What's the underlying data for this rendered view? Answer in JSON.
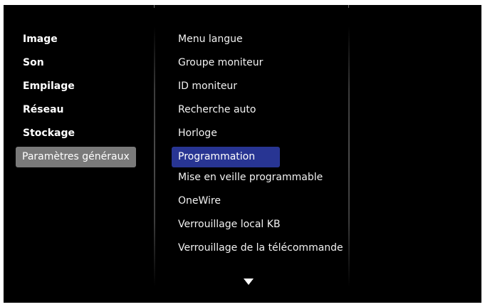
{
  "left_menu": {
    "items": [
      {
        "label": "Image"
      },
      {
        "label": "Son"
      },
      {
        "label": "Empilage"
      },
      {
        "label": "Réseau"
      },
      {
        "label": "Stockage"
      },
      {
        "label": "Paramètres généraux"
      }
    ],
    "selected_index": 5
  },
  "sub_menu": {
    "items": [
      {
        "label": "Menu langue"
      },
      {
        "label": "Groupe moniteur"
      },
      {
        "label": "ID moniteur"
      },
      {
        "label": "Recherche auto"
      },
      {
        "label": "Horloge"
      },
      {
        "label": "Programmation"
      },
      {
        "label": "Mise en veille programmable"
      },
      {
        "label": "OneWire"
      },
      {
        "label": "Verrouillage local KB"
      },
      {
        "label": "Verrouillage de la télécommande"
      }
    ],
    "selected_index": 5,
    "more_indicator": "down-arrow-icon"
  },
  "colors": {
    "background": "#000000",
    "left_selected": "#7a7a7a",
    "sub_selected": "#283593",
    "text": "#ffffff"
  }
}
